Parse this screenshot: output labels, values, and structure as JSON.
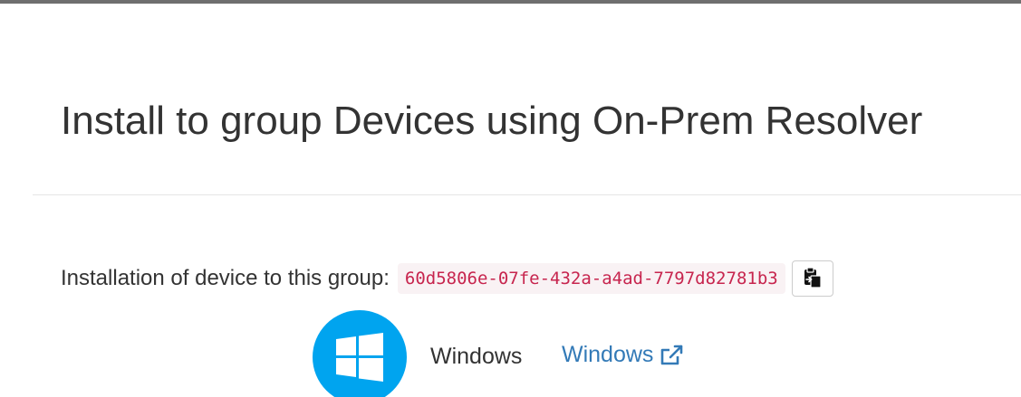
{
  "modal": {
    "title": "Install to group Devices using On-Prem Resolver"
  },
  "install": {
    "label": "Installation of device to this group:",
    "group_id": "60d5806e-07fe-432a-a4ad-7797d82781b3",
    "copy_icon": "clipboard-copy-icon"
  },
  "platforms": [
    {
      "logo_icon": "windows-logo-icon",
      "name": "Windows",
      "link_text": "Windows",
      "link_icon": "external-link-icon"
    }
  ],
  "colors": {
    "title_text": "#333333",
    "code_text": "#c7254e",
    "code_bg": "#f9f2f4",
    "link": "#337ab7",
    "windows_blue": "#00a4ef"
  }
}
